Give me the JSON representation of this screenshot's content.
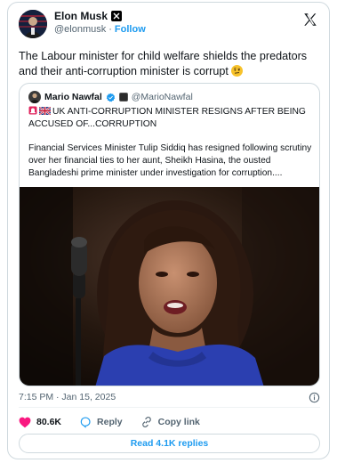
{
  "author": {
    "name": "Elon Musk",
    "handle": "@elonmusk",
    "separator": "·",
    "follow_label": "Follow"
  },
  "tweet": {
    "text": "The Labour minister for child welfare shields the predators and their anti-corruption minister is corrupt",
    "emoji": "raised-eyebrow-face",
    "timestamp": "7:15 PM · Jan 15, 2025"
  },
  "quoted": {
    "name": "Mario Nawfal",
    "handle": "@MarioNawfal",
    "headline": "UK ANTI-CORRUPTION MINISTER RESIGNS AFTER BEING ACCUSED OF...CORRUPTION",
    "flags": [
      "siren",
      "uk-flag"
    ],
    "body": "Financial Services Minister Tulip Siddiq has resigned following scrutiny over her financial ties to her aunt, Sheikh Hasina, the ousted Bangladeshi prime minister under investigation for corruption...."
  },
  "actions": {
    "like_count": "80.6K",
    "reply_label": "Reply",
    "copy_label": "Copy link",
    "read_replies_label": "Read 4.1K replies"
  },
  "colors": {
    "accent": "#1d9bf0",
    "like": "#f91880",
    "text": "#0f1419",
    "muted": "#536471",
    "border": "#cfd9de"
  }
}
